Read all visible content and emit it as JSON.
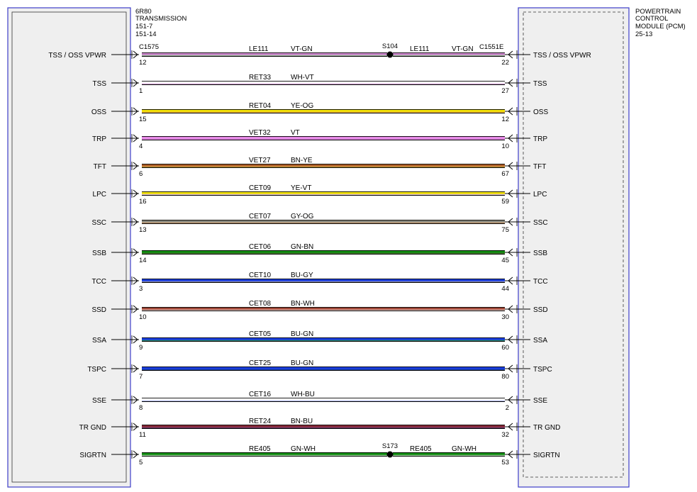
{
  "left_component": {
    "lines": [
      "6R80",
      "TRANSMISSION",
      "151-7",
      "151-14"
    ],
    "connector": "C1575",
    "fill": "#efefef",
    "border_color": "#3c3cc8"
  },
  "right_component": {
    "lines": [
      "POWERTRAIN",
      "CONTROL",
      "MODULE (PCM)",
      "25-13"
    ],
    "connector": "C1551E",
    "fill": "#efefef",
    "border_color": "#3c3cc8"
  },
  "splice_color": "#000000",
  "circuits": [
    {
      "left_label": "TSS / OSS VPWR",
      "right_label": "TSS / OSS VPWR",
      "left_pin": "12",
      "right_pin": "22",
      "circuit": "LE111",
      "color_code": "VT-GN",
      "colors": [
        "#cc88cc",
        "#9cba9c"
      ],
      "splice": {
        "id": "S104",
        "circuit2": "LE111",
        "color2": "VT-GN"
      }
    },
    {
      "left_label": "TSS",
      "right_label": "TSS",
      "left_pin": "1",
      "right_pin": "27",
      "circuit": "RET33",
      "color_code": "WH-VT",
      "colors": [
        "#ffffff",
        "#d8a8d8"
      ]
    },
    {
      "left_label": "OSS",
      "right_label": "OSS",
      "left_pin": "15",
      "right_pin": "12",
      "circuit": "RET04",
      "color_code": "YE-OG",
      "colors": [
        "#f0e000",
        "#e8b040"
      ]
    },
    {
      "left_label": "TRP",
      "right_label": "TRP",
      "left_pin": "4",
      "right_pin": "10",
      "circuit": "VET32",
      "color_code": "VT",
      "colors": [
        "#e388e3",
        "#e388e3"
      ]
    },
    {
      "left_label": "TFT",
      "right_label": "TFT",
      "left_pin": "6",
      "right_pin": "67",
      "circuit": "VET27",
      "color_code": "BN-YE",
      "colors": [
        "#b0602a",
        "#c8a040"
      ]
    },
    {
      "left_label": "LPC",
      "right_label": "LPC",
      "left_pin": "16",
      "right_pin": "59",
      "circuit": "CET09",
      "color_code": "YE-VT",
      "colors": [
        "#f0e000",
        "#e0c0e0"
      ]
    },
    {
      "left_label": "SSC",
      "right_label": "SSC",
      "left_pin": "13",
      "right_pin": "75",
      "circuit": "CET07",
      "color_code": "GY-OG",
      "colors": [
        "#8a8a80",
        "#c89a70"
      ]
    },
    {
      "left_label": "SSB",
      "right_label": "SSB",
      "left_pin": "14",
      "right_pin": "45",
      "circuit": "CET06",
      "color_code": "GN-BN",
      "colors": [
        "#0f8a0f",
        "#4a7a30"
      ]
    },
    {
      "left_label": "TCC",
      "right_label": "TCC",
      "left_pin": "3",
      "right_pin": "44",
      "circuit": "CET10",
      "color_code": "BU-GY",
      "colors": [
        "#1a3ee0",
        "#8c8ca8"
      ]
    },
    {
      "left_label": "SSD",
      "right_label": "SSD",
      "left_pin": "10",
      "right_pin": "30",
      "circuit": "CET08",
      "color_code": "BN-WH",
      "colors": [
        "#a04838",
        "#e8c8c0"
      ]
    },
    {
      "left_label": "SSA",
      "right_label": "SSA",
      "left_pin": "9",
      "right_pin": "60",
      "circuit": "CET05",
      "color_code": "BU-GN",
      "colors": [
        "#1a3ee0",
        "#2a8a60"
      ]
    },
    {
      "left_label": "TSPC",
      "right_label": "TSPC",
      "left_pin": "7",
      "right_pin": "80",
      "circuit": "CET25",
      "color_code": "BU-GN",
      "colors": [
        "#1a3ee0",
        "#1a3ea0"
      ]
    },
    {
      "left_label": "SSE",
      "right_label": "SSE",
      "left_pin": "8",
      "right_pin": "2",
      "circuit": "CET16",
      "color_code": "WH-BU",
      "colors": [
        "#ffffff",
        "#b8c0f0"
      ]
    },
    {
      "left_label": "TR GND",
      "right_label": "TR GND",
      "left_pin": "11",
      "right_pin": "32",
      "circuit": "RET24",
      "color_code": "BN-BU",
      "colors": [
        "#8a2a3a",
        "#6a3a6a"
      ]
    },
    {
      "left_label": "SIGRTN",
      "right_label": "SIGRTN",
      "left_pin": "5",
      "right_pin": "53",
      "circuit": "RE405",
      "color_code": "GN-WH",
      "colors": [
        "#0f8a0f",
        "#a0d0a0"
      ],
      "splice": {
        "id": "S173",
        "circuit2": "RE405",
        "color2": "GN-WH"
      }
    }
  ]
}
